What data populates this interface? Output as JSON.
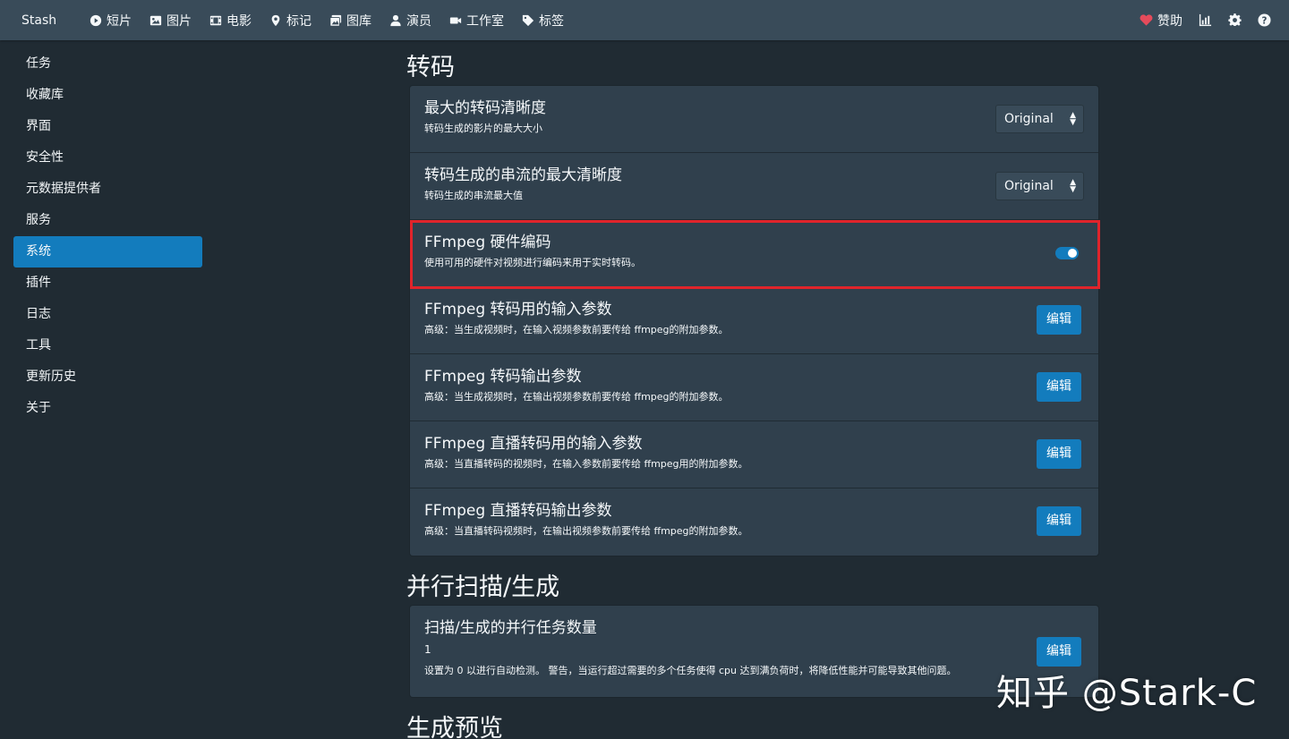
{
  "nav": {
    "brand": "Stash",
    "items": [
      {
        "label": "短片",
        "icon": "play-circle-icon"
      },
      {
        "label": "图片",
        "icon": "image-icon"
      },
      {
        "label": "电影",
        "icon": "film-icon"
      },
      {
        "label": "标记",
        "icon": "map-marker-icon"
      },
      {
        "label": "图库",
        "icon": "images-icon"
      },
      {
        "label": "演员",
        "icon": "user-icon"
      },
      {
        "label": "工作室",
        "icon": "video-camera-icon"
      },
      {
        "label": "标签",
        "icon": "tag-icon"
      }
    ],
    "donate": "赞助",
    "colors": {
      "bar": "#394b59",
      "heart": "#e54b5b"
    }
  },
  "sidebar": {
    "items": [
      {
        "label": "任务"
      },
      {
        "label": "收藏库"
      },
      {
        "label": "界面"
      },
      {
        "label": "安全性"
      },
      {
        "label": "元数据提供者"
      },
      {
        "label": "服务"
      },
      {
        "label": "系统",
        "active": true
      },
      {
        "label": "插件"
      },
      {
        "label": "日志"
      },
      {
        "label": "工具"
      },
      {
        "label": "更新历史"
      },
      {
        "label": "关于"
      }
    ]
  },
  "transcode": {
    "title": "转码",
    "rows": [
      {
        "title": "最大的转码清晰度",
        "sub": "转码生成的影片的最大大小",
        "control": "select",
        "value": "Original"
      },
      {
        "title": "转码生成的串流的最大清晰度",
        "sub": "转码生成的串流最大值",
        "control": "select",
        "value": "Original"
      },
      {
        "title": "FFmpeg 硬件编码",
        "sub": "使用可用的硬件对视频进行编码来用于实时转码。",
        "control": "toggle",
        "value": true
      },
      {
        "title": "FFmpeg 转码用的输入参数",
        "sub": "高级：当生成视频时，在输入视频参数前要传给 ffmpeg的附加参数。",
        "control": "button",
        "button": "编辑"
      },
      {
        "title": "FFmpeg 转码输出参数",
        "sub": "高级：当生成视频时，在输出视频参数前要传给 ffmpeg的附加参数。",
        "control": "button",
        "button": "编辑"
      },
      {
        "title": "FFmpeg 直播转码用的输入参数",
        "sub": "高级：当直播转码的视频时，在输入参数前要传给 ffmpeg用的附加参数。",
        "control": "button",
        "button": "编辑"
      },
      {
        "title": "FFmpeg 直播转码输出参数",
        "sub": "高级：当直播转码视频时，在输出视频参数前要传给 ffmpeg的附加参数。",
        "control": "button",
        "button": "编辑"
      }
    ]
  },
  "parallel": {
    "title": "并行扫描/生成",
    "row": {
      "title": "扫描/生成的并行任务数量",
      "value": "1",
      "sub": "设置为 0 以进行自动检测。 警告，当运行超过需要的多个任务使得 cpu 达到满负荷时，将降低性能并可能导致其他问题。",
      "button": "编辑"
    }
  },
  "next_section_title": "生成预览",
  "watermark": "知乎 @Stark-C",
  "colors": {
    "accent": "#137cbd",
    "highlight": "#e0242b",
    "card": "#30404d",
    "background": "#202b33"
  }
}
